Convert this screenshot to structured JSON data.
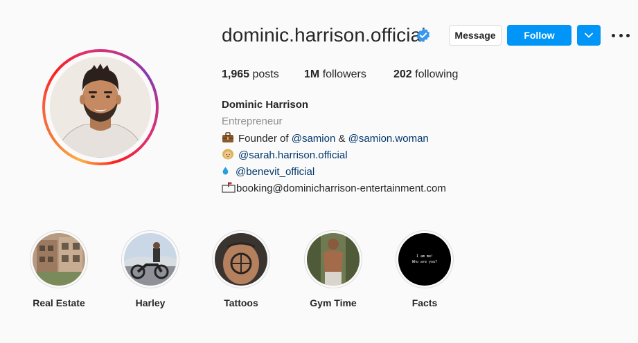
{
  "profile": {
    "username": "dominic.harrison.official",
    "verified": true,
    "avatar_icon": "profile-illustration",
    "buttons": {
      "message": "Message",
      "follow": "Follow"
    },
    "stats": {
      "posts_count": "1,965",
      "posts_label": "posts",
      "followers_count": "1M",
      "followers_label": "followers",
      "following_count": "202",
      "following_label": "following"
    }
  },
  "bio": {
    "name": "Dominic Harrison",
    "category": "Entrepreneur",
    "line1_prefix": "Founder of",
    "line1_link1": "@samion",
    "line1_amp": "&",
    "line1_link2": "@samion.woman",
    "line2_link": "@sarah.harrison.official",
    "line3_link": "@benevit_official",
    "line4_text": "booking@dominicharrison-entertainment.com",
    "icons": [
      "briefcase-icon",
      "woman-face-icon",
      "droplet-icon",
      "mailbox-icon"
    ]
  },
  "highlights": [
    {
      "label": "Real Estate"
    },
    {
      "label": "Harley"
    },
    {
      "label": "Tattoos"
    },
    {
      "label": "Gym Time"
    },
    {
      "label": "Facts",
      "cover_line1": "I am me!",
      "cover_line2": "Who are you?"
    }
  ],
  "colors": {
    "accent": "#0095f6",
    "link": "#00376b",
    "muted": "#8e8e8e",
    "text": "#262626",
    "background": "#fafafa"
  }
}
